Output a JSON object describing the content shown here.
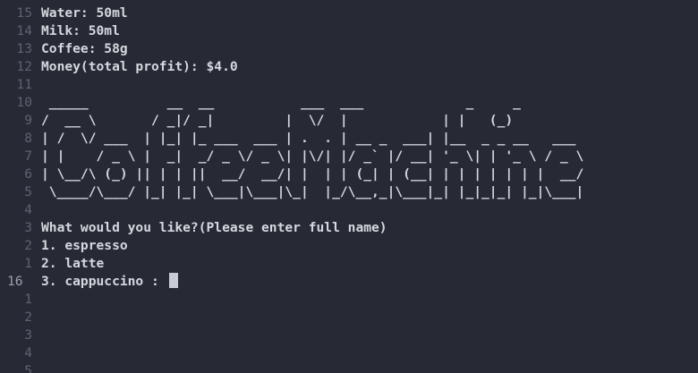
{
  "terminal": {
    "lines": [
      {
        "num": "15",
        "text": "Water: 50ml"
      },
      {
        "num": "14",
        "text": "Milk: 50ml"
      },
      {
        "num": "13",
        "text": "Coffee: 58g"
      },
      {
        "num": "12",
        "text": "Money(total profit): $4.0"
      },
      {
        "num": "11",
        "text": ""
      },
      {
        "num": "10",
        "text": " _____          __  __           ___  ___             _     _"
      },
      {
        "num": "9",
        "text": "/  __ \\       / _|/ _|         |  \\/  |            | |   (_)"
      },
      {
        "num": "8",
        "text": "| /  \\/ ___  | |_| |_ ___  ___ | .  . | __ _  ___| |__  _ _ __   ___"
      },
      {
        "num": "7",
        "text": "| |    / _ \\ |  _|  _/ _ \\/ _ \\| |\\/| |/ _` |/ __| '_ \\| | '_ \\ / _ \\"
      },
      {
        "num": "6",
        "text": "| \\__/\\ (_) || | | ||  __/  __/| |  | | (_| | (__| | | | | | | |  __/"
      },
      {
        "num": "5",
        "text": " \\____/\\___/ |_| |_| \\___|\\___|\\_|  |_/\\__,_|\\___|_| |_|_|_| |_|\\___|"
      },
      {
        "num": "4",
        "text": ""
      },
      {
        "num": "3",
        "text": "What would you like?(Please enter full name)"
      },
      {
        "num": "2",
        "text": "1. espresso"
      },
      {
        "num": "1",
        "text": "2. latte"
      },
      {
        "num": "16",
        "text": "3. cappuccino : ",
        "current": true
      },
      {
        "num": "1",
        "text": ""
      },
      {
        "num": "2",
        "text": ""
      },
      {
        "num": "3",
        "text": ""
      },
      {
        "num": "4",
        "text": ""
      },
      {
        "num": "5",
        "text": ""
      }
    ]
  },
  "colors": {
    "background": "#272a35",
    "text": "#d6d8de",
    "line_number": "#5f6370",
    "cursor": "#c8ccd4"
  }
}
